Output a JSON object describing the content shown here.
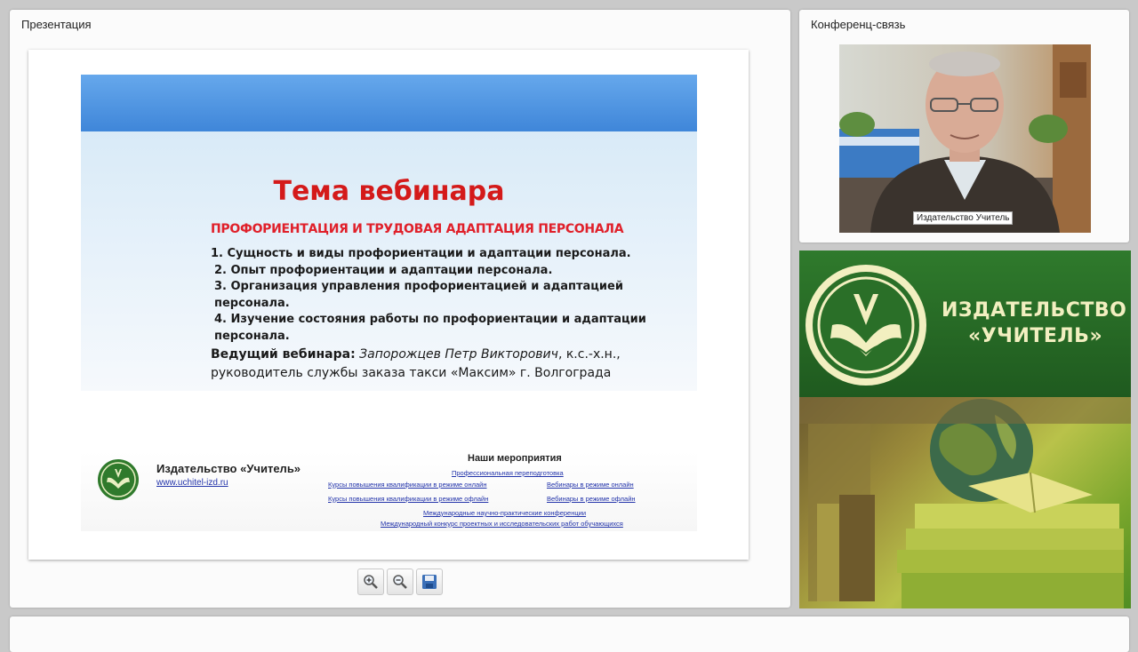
{
  "presentation": {
    "title": "Презентация",
    "slide": {
      "heading": "Тема вебинара",
      "subtitle": "ПРОФОРИЕНТАЦИЯ И ТРУДОВАЯ АДАПТАЦИЯ ПЕРСОНАЛА",
      "points": [
        "1. Сущность и виды профориентации и адаптации персонала.",
        "2. Опыт профориентации и адаптации персонала.",
        "3. Организация управления профориентацией и адаптацией персонала.",
        "4. Изучение состояния работы по профориентации и адаптации персонала."
      ],
      "host_label": "Ведущий вебинара:",
      "host_name": "Запорожцев Петр Викторович",
      "host_rest": ", к.с.-х.н., руководитель службы заказа такси «Максим» г. Волгограда",
      "footer": {
        "publisher": "Издательство «Учитель»",
        "url": "www.uchitel-izd.ru",
        "events_title": "Наши мероприятия",
        "events": [
          "Профессиональная переподготовка",
          "Курсы повышения квалификации в режиме онлайн",
          "Вебинары в режиме онлайн",
          "Курсы повышения квалификации в режиме офлайн",
          "Вебинары в режиме офлайн",
          "Международные научно-практические конференции",
          "Международный конкурс проектных и исследовательских работ обучающихся"
        ]
      }
    },
    "toolbar": [
      "zoom-in-icon",
      "zoom-out-icon",
      "save-icon"
    ]
  },
  "conference": {
    "title": "Конференц-связь",
    "video_label": "Издательство Учитель"
  },
  "banner": {
    "line1": "ИЗДАТЕЛЬСТВО",
    "line2": "«УЧИТЕЛЬ»"
  },
  "colors": {
    "accent_red": "#d41a1a",
    "brand_green": "#215f22",
    "slide_band_blue": "#3f86d9"
  }
}
